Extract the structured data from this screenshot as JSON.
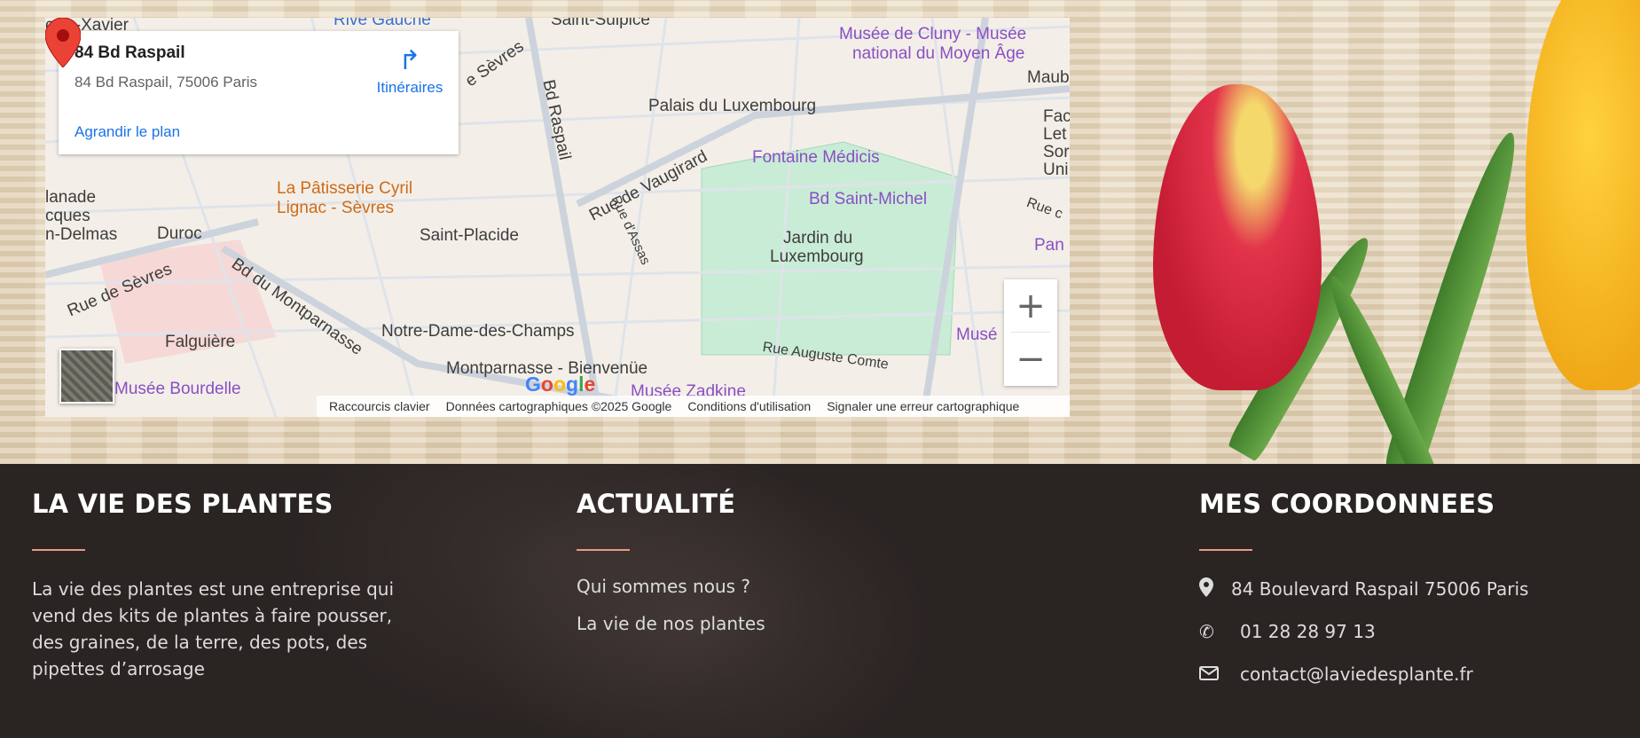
{
  "map": {
    "info_card": {
      "title": "84 Bd Raspail",
      "address": "84 Bd Raspail, 75006 Paris",
      "directions_label": "Itinéraires",
      "enlarge_label": "Agrandir le plan"
    },
    "labels": [
      {
        "text": "çois-Xavier",
        "cls": "dark"
      },
      {
        "text": "Rive Gauche",
        "cls": "blue"
      },
      {
        "text": "Saint-Sulpice",
        "cls": "dark"
      },
      {
        "text": "Musée de Cluny - Musée",
        "cls": "purple"
      },
      {
        "text": "national du Moyen Âge",
        "cls": "purple"
      },
      {
        "text": "Maub",
        "cls": "dark"
      },
      {
        "text": "Palais du Luxembourg",
        "cls": "dark"
      },
      {
        "text": "Fontaine Médicis",
        "cls": "purple"
      },
      {
        "text": "Bd Saint-Michel",
        "cls": "purple"
      },
      {
        "text": "La Pâtisserie Cyril",
        "cls": "orange"
      },
      {
        "text": "Lignac - Sèvres",
        "cls": "orange"
      },
      {
        "text": "Saint-Placide",
        "cls": "dark"
      },
      {
        "text": "Duroc",
        "cls": "dark"
      },
      {
        "text": "lanade",
        "cls": "dark"
      },
      {
        "text": "cques",
        "cls": "dark"
      },
      {
        "text": "n-Delmas",
        "cls": "dark"
      },
      {
        "text": "Jardin du",
        "cls": "dark"
      },
      {
        "text": "Luxembourg",
        "cls": "dark"
      },
      {
        "text": "Notre-Dame-des-Champs",
        "cls": "dark"
      },
      {
        "text": "Falguière",
        "cls": "dark"
      },
      {
        "text": "Montparnasse - Bienvenüe",
        "cls": "dark"
      },
      {
        "text": "Musée Bourdelle",
        "cls": "purple"
      },
      {
        "text": "Musée Zadkine",
        "cls": "purple"
      },
      {
        "text": "Rue Auguste Comte",
        "cls": "dark"
      },
      {
        "text": "Musé",
        "cls": "purple"
      },
      {
        "text": "Pan",
        "cls": "purple"
      },
      {
        "text": "Fac",
        "cls": "dark"
      },
      {
        "text": "Let",
        "cls": "dark"
      },
      {
        "text": "Sor",
        "cls": "dark"
      },
      {
        "text": "Uni",
        "cls": "dark"
      },
      {
        "text": "Rue c",
        "cls": "dark"
      },
      {
        "text": "Rue de Vaugirard",
        "cls": "dark"
      },
      {
        "text": "Bd Raspail",
        "cls": "dark"
      },
      {
        "text": "Rue de Sèvres",
        "cls": "dark"
      },
      {
        "text": "Bd du Montparnasse",
        "cls": "dark"
      },
      {
        "text": "Rue d'Assas",
        "cls": "dark"
      },
      {
        "text": "e Sèvres",
        "cls": "dark"
      }
    ],
    "zoom_in": "+",
    "zoom_out": "−",
    "google": "Google",
    "attribution": {
      "shortcuts": "Raccourcis clavier",
      "data": "Données cartographiques ©2025 Google",
      "terms": "Conditions d'utilisation",
      "report": "Signaler une erreur cartographique"
    }
  },
  "footer": {
    "about": {
      "heading": "LA VIE DES PLANTES",
      "text": "La vie des plantes est une entreprise qui vend des kits de plantes à faire pousser, des graines, de la terre, des pots, des pipettes d’arrosage"
    },
    "news": {
      "heading": "ACTUALITÉ",
      "links": [
        "Qui sommes nous ?",
        "La vie de nos plantes"
      ]
    },
    "contact": {
      "heading": "MES COORDONNEES",
      "address": "84 Boulevard Raspail 75006 Paris",
      "phone": "01 28 28 97 13",
      "email": "contact@laviedesplante.fr"
    }
  },
  "colors": {
    "accent": "#e79a80",
    "footer_bg": "#2a2423",
    "map_link": "#1a73e8",
    "poi_purple": "#8a4fc4"
  }
}
